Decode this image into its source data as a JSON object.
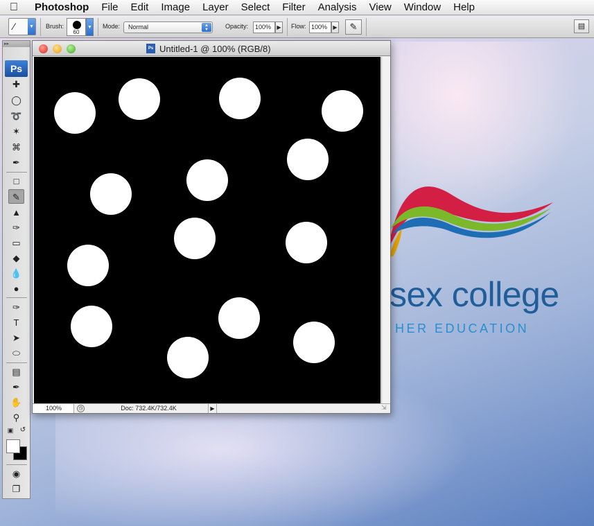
{
  "menubar": {
    "apple_icon": "apple-icon",
    "app_name": "Photoshop",
    "items": [
      "File",
      "Edit",
      "Image",
      "Layer",
      "Select",
      "Filter",
      "Analysis",
      "View",
      "Window",
      "Help"
    ]
  },
  "options_bar": {
    "brush_label": "Brush:",
    "brush_size": "60",
    "mode_label": "Mode:",
    "mode_value": "Normal",
    "opacity_label": "Opacity:",
    "opacity_value": "100%",
    "flow_label": "Flow:",
    "flow_value": "100%"
  },
  "toolbox": {
    "logo": "Ps",
    "active_tool": "brush-tool"
  },
  "document": {
    "title": "Untitled-1 @ 100% (RGB/8)",
    "icon_text": "Ps",
    "status_zoom": "100%",
    "status_doc": "Doc: 732.4K/732.4K",
    "canvas_background": "#000000",
    "dot_color": "#ffffff"
  },
  "wallpaper": {
    "college_text": "sex college",
    "college_sub": "HER EDUCATION",
    "brand_colors": [
      "#d41f45",
      "#7bb82a",
      "#1f5e99",
      "#e6a200"
    ]
  }
}
